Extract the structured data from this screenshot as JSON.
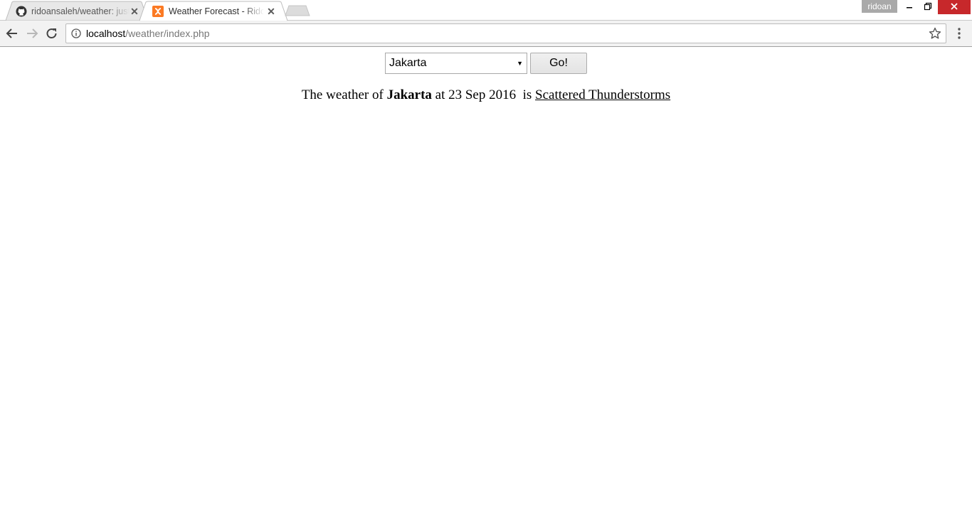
{
  "browser": {
    "tabs": [
      {
        "title": "ridoansaleh/weather: just",
        "icon": "github-icon"
      },
      {
        "title": "Weather Forecast - Ridoan",
        "icon": "xampp-icon",
        "active": true
      }
    ],
    "profile": "ridoan",
    "address": {
      "host": "localhost",
      "path": "/weather/index.php"
    },
    "colors": {
      "close_button": "#c7282b",
      "favicon_xampp": "#fb7a24"
    }
  },
  "page": {
    "city_select": {
      "selected": "Jakarta"
    },
    "go_button": "Go!",
    "result": {
      "prefix": "The weather of",
      "city": "Jakarta",
      "mid": "at 23 Sep 2016  is",
      "condition": "Scattered Thunderstorms"
    }
  }
}
